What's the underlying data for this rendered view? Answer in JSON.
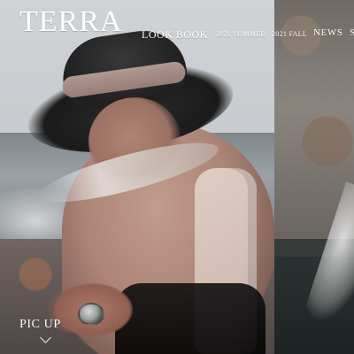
{
  "brand": {
    "logo": "TERRA"
  },
  "nav": {
    "look_book": "LOOK BOOK",
    "summer": "2021 SUMMER",
    "fall": "2021 FALL",
    "news": "NEWS",
    "next_cut": "S"
  },
  "pickup": {
    "label": "PIC UP"
  },
  "icons": {
    "scroll": "chevron-down-icon"
  }
}
